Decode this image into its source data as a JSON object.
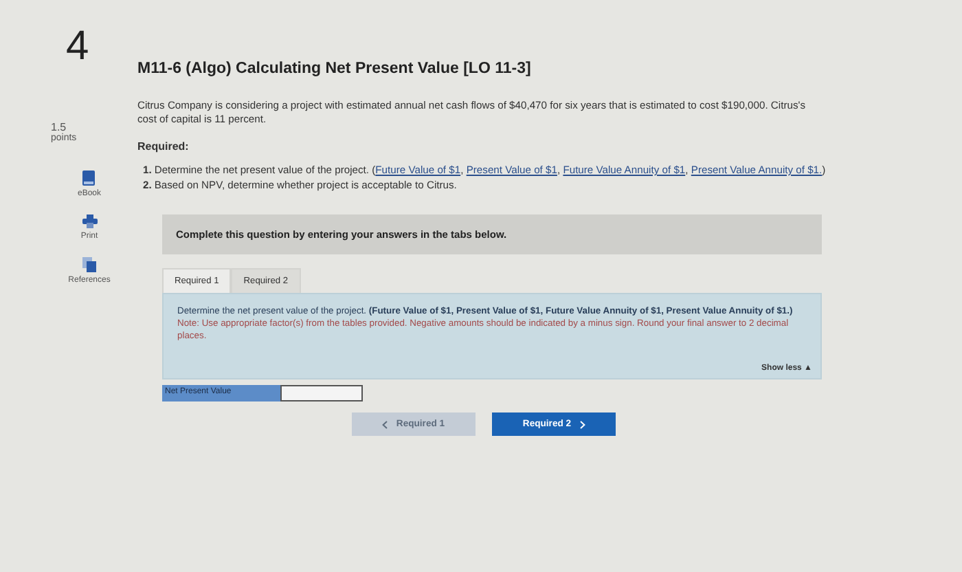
{
  "question_number": "4",
  "points": {
    "value": "1.5",
    "label": "points"
  },
  "sidebar": [
    {
      "kind": "ebook",
      "label": "eBook"
    },
    {
      "kind": "print",
      "label": "Print"
    },
    {
      "kind": "references",
      "label": "References"
    }
  ],
  "title": "M11-6 (Algo) Calculating Net Present Value [LO 11-3]",
  "problem": "Citrus Company is considering a project with estimated annual net cash flows of $40,470 for six years that is estimated to cost $190,000. Citrus's cost of capital is 11 percent.",
  "required_heading": "Required:",
  "requirements": [
    {
      "number": "1.",
      "text": "Determine the net present value of the project.",
      "links_open": "(",
      "links_sep": ", ",
      "links_close": ")",
      "links": [
        "Future Value of $1",
        "Present Value of $1",
        "Future Value Annuity of $1",
        "Present Value Annuity of $1."
      ]
    },
    {
      "number": "2.",
      "text": "Based on NPV, determine whether project is acceptable to Citrus."
    }
  ],
  "instruction_bar": "Complete this question by entering your answers in the tabs below.",
  "tabs": [
    {
      "label": "Required 1",
      "selected": true
    },
    {
      "label": "Required 2",
      "selected": false
    }
  ],
  "panel": {
    "text": "Determine the net present value of the project. **(Future Value of $1, Present Value of $1, Future Value Annuity of $1, Present Value Annuity of $1.)**",
    "note": "Note: Use appropriate factor(s) from the tables provided. Negative amounts should be indicated by a minus sign. Round your final answer to 2 decimal places.",
    "toggle": "Show less ▲"
  },
  "answer": {
    "label": "Net Present Value"
  },
  "nav": [
    {
      "label": "Required 1",
      "kind": "prev",
      "disabled": true
    },
    {
      "label": "Required 2",
      "kind": "next",
      "disabled": false
    }
  ]
}
